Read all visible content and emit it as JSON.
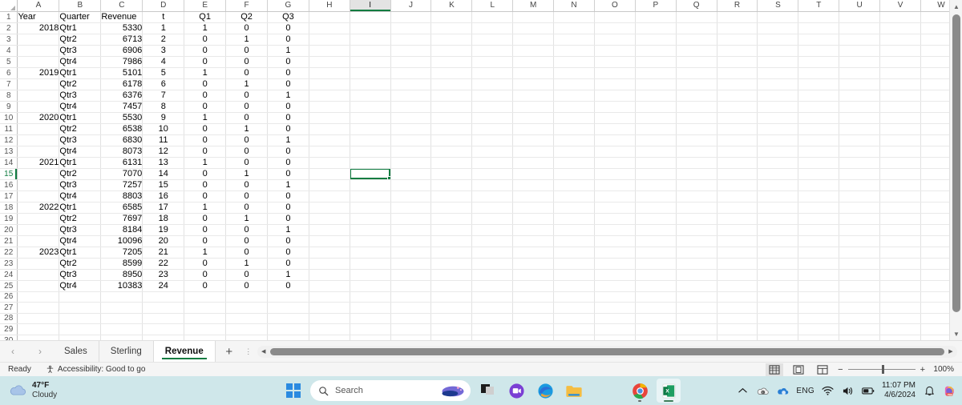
{
  "spreadsheet": {
    "columns": [
      "A",
      "B",
      "C",
      "D",
      "E",
      "F",
      "G",
      "H",
      "I",
      "J",
      "K",
      "L",
      "M",
      "N",
      "O",
      "P",
      "Q",
      "R",
      "S",
      "T",
      "U",
      "V",
      "W"
    ],
    "active_column": "I",
    "active_row": 15,
    "selected_cell": "I15",
    "row_count": 30,
    "headers": {
      "A": "Year",
      "B": "Quarter",
      "C": "Revenue",
      "D": "t",
      "E": "Q1",
      "F": "Q2",
      "G": "Q3"
    },
    "rows": [
      {
        "n": 1,
        "A": "Year",
        "B": "Quarter",
        "C": "Revenue",
        "D": "t",
        "E": "Q1",
        "F": "Q2",
        "G": "Q3"
      },
      {
        "n": 2,
        "A": "2018",
        "B": "Qtr1",
        "C": "5330",
        "D": "1",
        "E": "1",
        "F": "0",
        "G": "0"
      },
      {
        "n": 3,
        "A": "",
        "B": "Qtr2",
        "C": "6713",
        "D": "2",
        "E": "0",
        "F": "1",
        "G": "0"
      },
      {
        "n": 4,
        "A": "",
        "B": "Qtr3",
        "C": "6906",
        "D": "3",
        "E": "0",
        "F": "0",
        "G": "1"
      },
      {
        "n": 5,
        "A": "",
        "B": "Qtr4",
        "C": "7986",
        "D": "4",
        "E": "0",
        "F": "0",
        "G": "0"
      },
      {
        "n": 6,
        "A": "2019",
        "B": "Qtr1",
        "C": "5101",
        "D": "5",
        "E": "1",
        "F": "0",
        "G": "0"
      },
      {
        "n": 7,
        "A": "",
        "B": "Qtr2",
        "C": "6178",
        "D": "6",
        "E": "0",
        "F": "1",
        "G": "0"
      },
      {
        "n": 8,
        "A": "",
        "B": "Qtr3",
        "C": "6376",
        "D": "7",
        "E": "0",
        "F": "0",
        "G": "1"
      },
      {
        "n": 9,
        "A": "",
        "B": "Qtr4",
        "C": "7457",
        "D": "8",
        "E": "0",
        "F": "0",
        "G": "0"
      },
      {
        "n": 10,
        "A": "2020",
        "B": "Qtr1",
        "C": "5530",
        "D": "9",
        "E": "1",
        "F": "0",
        "G": "0"
      },
      {
        "n": 11,
        "A": "",
        "B": "Qtr2",
        "C": "6538",
        "D": "10",
        "E": "0",
        "F": "1",
        "G": "0"
      },
      {
        "n": 12,
        "A": "",
        "B": "Qtr3",
        "C": "6830",
        "D": "11",
        "E": "0",
        "F": "0",
        "G": "1"
      },
      {
        "n": 13,
        "A": "",
        "B": "Qtr4",
        "C": "8073",
        "D": "12",
        "E": "0",
        "F": "0",
        "G": "0"
      },
      {
        "n": 14,
        "A": "2021",
        "B": "Qtr1",
        "C": "6131",
        "D": "13",
        "E": "1",
        "F": "0",
        "G": "0"
      },
      {
        "n": 15,
        "A": "",
        "B": "Qtr2",
        "C": "7070",
        "D": "14",
        "E": "0",
        "F": "1",
        "G": "0"
      },
      {
        "n": 16,
        "A": "",
        "B": "Qtr3",
        "C": "7257",
        "D": "15",
        "E": "0",
        "F": "0",
        "G": "1"
      },
      {
        "n": 17,
        "A": "",
        "B": "Qtr4",
        "C": "8803",
        "D": "16",
        "E": "0",
        "F": "0",
        "G": "0"
      },
      {
        "n": 18,
        "A": "2022",
        "B": "Qtr1",
        "C": "6585",
        "D": "17",
        "E": "1",
        "F": "0",
        "G": "0"
      },
      {
        "n": 19,
        "A": "",
        "B": "Qtr2",
        "C": "7697",
        "D": "18",
        "E": "0",
        "F": "1",
        "G": "0"
      },
      {
        "n": 20,
        "A": "",
        "B": "Qtr3",
        "C": "8184",
        "D": "19",
        "E": "0",
        "F": "0",
        "G": "1"
      },
      {
        "n": 21,
        "A": "",
        "B": "Qtr4",
        "C": "10096",
        "D": "20",
        "E": "0",
        "F": "0",
        "G": "0"
      },
      {
        "n": 22,
        "A": "2023",
        "B": "Qtr1",
        "C": "7205",
        "D": "21",
        "E": "1",
        "F": "0",
        "G": "0"
      },
      {
        "n": 23,
        "A": "",
        "B": "Qtr2",
        "C": "8599",
        "D": "22",
        "E": "0",
        "F": "1",
        "G": "0"
      },
      {
        "n": 24,
        "A": "",
        "B": "Qtr3",
        "C": "8950",
        "D": "23",
        "E": "0",
        "F": "0",
        "G": "1"
      },
      {
        "n": 25,
        "A": "",
        "B": "Qtr4",
        "C": "10383",
        "D": "24",
        "E": "0",
        "F": "0",
        "G": "0"
      },
      {
        "n": 26,
        "A": "",
        "B": "",
        "C": "",
        "D": "",
        "E": "",
        "F": "",
        "G": ""
      },
      {
        "n": 27,
        "A": "",
        "B": "",
        "C": "",
        "D": "",
        "E": "",
        "F": "",
        "G": ""
      },
      {
        "n": 28,
        "A": "",
        "B": "",
        "C": "",
        "D": "",
        "E": "",
        "F": "",
        "G": ""
      },
      {
        "n": 29,
        "A": "",
        "B": "",
        "C": "",
        "D": "",
        "E": "",
        "F": "",
        "G": ""
      },
      {
        "n": 30,
        "A": "",
        "B": "",
        "C": "",
        "D": "",
        "E": "",
        "F": "",
        "G": ""
      }
    ]
  },
  "sheet_tabs": {
    "prev_label": "‹",
    "next_label": "›",
    "add_label": "+",
    "tabs": [
      {
        "label": "Sales",
        "active": false
      },
      {
        "label": "Sterling",
        "active": false
      },
      {
        "label": "Revenue",
        "active": true
      }
    ]
  },
  "status_bar": {
    "mode": "Ready",
    "accessibility": "Accessibility: Good to go",
    "views": [
      {
        "name": "normal-view",
        "active": true
      },
      {
        "name": "page-layout-view",
        "active": false
      },
      {
        "name": "page-break-view",
        "active": false
      }
    ],
    "zoom_minus": "−",
    "zoom_plus": "+",
    "zoom_level": "100%"
  },
  "taskbar": {
    "weather": {
      "temperature": "47°F",
      "condition": "Cloudy"
    },
    "search_placeholder": "Search",
    "language": "ENG",
    "time": "11:07 PM",
    "date": "4/6/2024"
  },
  "colors": {
    "excel_green": "#107c41",
    "taskbar_bg": "#cfe7ea",
    "grid_line": "#e2e2e2"
  }
}
